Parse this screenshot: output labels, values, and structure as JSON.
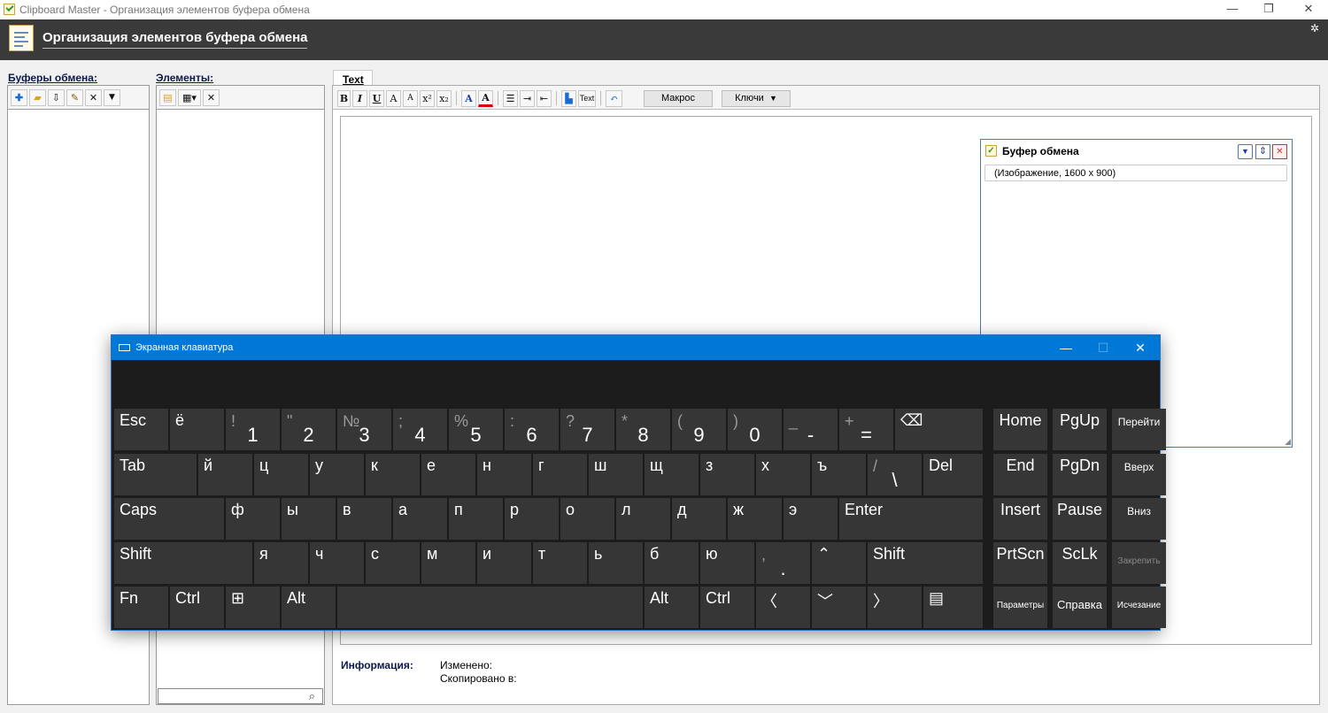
{
  "window": {
    "title": "Clipboard Master - Организация элементов буфера обмена",
    "minimize": "—",
    "restore": "❐",
    "close": "✕"
  },
  "header": {
    "title": "Организация элементов буфера обмена",
    "settings_icon": "gear-icon"
  },
  "panels": {
    "buffers": {
      "label": "Буферы обмена:",
      "toolbar": [
        "add",
        "open-folder",
        "paste",
        "edit",
        "delete",
        "dropdown"
      ]
    },
    "elements": {
      "label": "Элементы:",
      "toolbar": [
        "new-item",
        "paste-dropdown",
        "delete"
      ]
    }
  },
  "editor": {
    "tab": "Text",
    "toolbar": {
      "bold": "B",
      "italic": "I",
      "underline": "U",
      "grow": "A",
      "shrink": "A",
      "superscript": "x²",
      "subscript": "x₂",
      "font_color": "A",
      "highlight": "A",
      "macro_label": "Макрос",
      "keys_label": "Ключи",
      "text_label": "Text"
    }
  },
  "clipboard_window": {
    "title": "Буфер обмена",
    "item": "(Изображение,  1600 x 900)"
  },
  "info": {
    "label": "Информация:",
    "changed": "Изменено:",
    "copied_to": "Скопировано в:"
  },
  "keyboard": {
    "title": "Экранная клавиатура",
    "rows": [
      [
        {
          "m": "Esc"
        },
        {
          "m": "ё"
        },
        {
          "s": "!",
          "b": "1"
        },
        {
          "s": "\"",
          "b": "2"
        },
        {
          "s": "№",
          "b": "3"
        },
        {
          "s": ";",
          "b": "4"
        },
        {
          "s": "%",
          "b": "5"
        },
        {
          "s": ":",
          "b": "6"
        },
        {
          "s": "?",
          "b": "7"
        },
        {
          "s": "*",
          "b": "8"
        },
        {
          "s": "(",
          "b": "9"
        },
        {
          "s": ")",
          "b": "0"
        },
        {
          "s": "_",
          "b": "-"
        },
        {
          "s": "+",
          "b": "="
        },
        {
          "m": "⌫"
        }
      ],
      [
        {
          "m": "Tab"
        },
        {
          "m": "й"
        },
        {
          "m": "ц"
        },
        {
          "m": "у"
        },
        {
          "m": "к"
        },
        {
          "m": "е"
        },
        {
          "m": "н"
        },
        {
          "m": "г"
        },
        {
          "m": "ш"
        },
        {
          "m": "щ"
        },
        {
          "m": "з"
        },
        {
          "m": "х"
        },
        {
          "m": "ъ"
        },
        {
          "s": "/",
          "b": "\\"
        },
        {
          "m": "Del"
        }
      ],
      [
        {
          "m": "Caps"
        },
        {
          "m": "ф"
        },
        {
          "m": "ы"
        },
        {
          "m": "в"
        },
        {
          "m": "а"
        },
        {
          "m": "п"
        },
        {
          "m": "р"
        },
        {
          "m": "о"
        },
        {
          "m": "л"
        },
        {
          "m": "д"
        },
        {
          "m": "ж"
        },
        {
          "m": "э"
        },
        {
          "m": "Enter"
        }
      ],
      [
        {
          "m": "Shift"
        },
        {
          "m": "я"
        },
        {
          "m": "ч"
        },
        {
          "m": "с"
        },
        {
          "m": "м"
        },
        {
          "m": "и"
        },
        {
          "m": "т"
        },
        {
          "m": "ь"
        },
        {
          "m": "б"
        },
        {
          "m": "ю"
        },
        {
          "s": ",",
          "b": "."
        },
        {
          "m": "⌃"
        },
        {
          "m": "Shift"
        }
      ],
      [
        {
          "m": "Fn"
        },
        {
          "m": "Ctrl"
        },
        {
          "m": "⊞"
        },
        {
          "m": "Alt"
        },
        {
          "m": ""
        },
        {
          "m": "Alt"
        },
        {
          "m": "Ctrl"
        },
        {
          "m": "〈"
        },
        {
          "m": "﹀"
        },
        {
          "m": "〉"
        },
        {
          "m": "▤"
        }
      ]
    ],
    "nav": [
      [
        "Home",
        "PgUp",
        "Перейти"
      ],
      [
        "End",
        "PgDn",
        "Вверх"
      ],
      [
        "Insert",
        "Pause",
        "Вниз"
      ],
      [
        "PrtScn",
        "ScLk",
        "Закрепить"
      ],
      [
        "Параметры",
        "Справка",
        "Исчезание"
      ]
    ]
  }
}
